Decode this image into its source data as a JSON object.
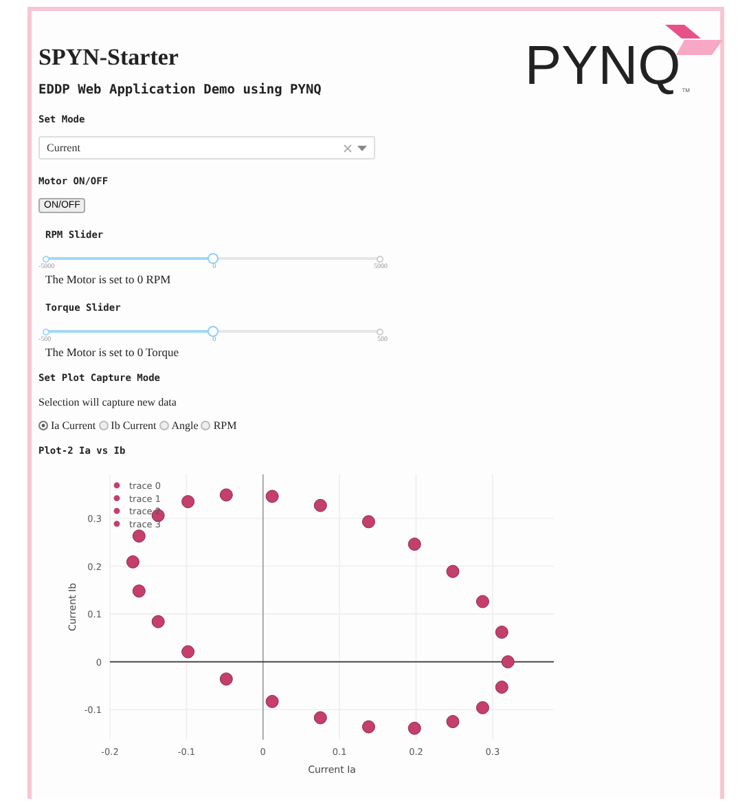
{
  "title": "SPYN-Starter",
  "logo": {
    "text": "PYNQ",
    "mark": "TM"
  },
  "subtitle": "EDDP Web Application Demo using PYNQ",
  "mode": {
    "label": "Set Mode",
    "value": "Current"
  },
  "motor": {
    "label": "Motor ON/OFF",
    "button": "ON/OFF"
  },
  "sliders": [
    {
      "label": "RPM Slider",
      "min": "-5000",
      "mid": "0",
      "max": "5000",
      "level": 0.5,
      "reading": "The Motor is set to 0 RPM"
    },
    {
      "label": "Torque Slider",
      "min": "-500",
      "mid": "0",
      "max": "500",
      "level": 0.5,
      "reading": "The Motor is set to 0 Torque"
    }
  ],
  "capture": {
    "label": "Set Plot Capture Mode",
    "note": "Selection will capture new data",
    "options": [
      {
        "label": "Ia Current",
        "selected": true
      },
      {
        "label": "Ib Current",
        "selected": false
      },
      {
        "label": "Angle",
        "selected": false
      },
      {
        "label": "RPM",
        "selected": false
      }
    ]
  },
  "plot": {
    "heading": "Plot-2 Ia vs Ib",
    "chart_data": {
      "type": "scatter",
      "grid": true,
      "legend": true,
      "xlabel": "Current Ia",
      "ylabel": "Current Ib",
      "xlim": [
        -0.2,
        0.38
      ],
      "ylim": [
        -0.163,
        0.392
      ],
      "xticks": [
        -0.2,
        -0.1,
        0,
        0.1,
        0.2,
        0.3
      ],
      "yticks": [
        -0.1,
        0,
        0.1,
        0.2,
        0.3
      ],
      "series": [
        {
          "name": "trace 0",
          "color": "#c43f6b",
          "x": [
            0.32,
            0.312,
            0.287,
            0.248,
            0.198,
            0.138
          ],
          "values": [
            0.0,
            0.062,
            0.126,
            0.189,
            0.246,
            0.293
          ]
        },
        {
          "name": "trace 1",
          "color": "#c43f6b",
          "x": [
            0.075,
            0.012,
            -0.048,
            -0.098,
            -0.137,
            -0.162
          ],
          "values": [
            0.327,
            0.346,
            0.349,
            0.335,
            0.306,
            0.263
          ]
        },
        {
          "name": "trace 2",
          "color": "#c43f6b",
          "x": [
            -0.17,
            -0.162,
            -0.137,
            -0.098,
            -0.048,
            0.012
          ],
          "values": [
            0.209,
            0.148,
            0.084,
            0.021,
            -0.036,
            -0.083
          ]
        },
        {
          "name": "trace 3",
          "color": "#c43f6b",
          "x": [
            0.075,
            0.138,
            0.198,
            0.248,
            0.287,
            0.312
          ],
          "values": [
            -0.117,
            -0.136,
            -0.139,
            -0.125,
            -0.096,
            -0.053
          ]
        }
      ]
    }
  }
}
